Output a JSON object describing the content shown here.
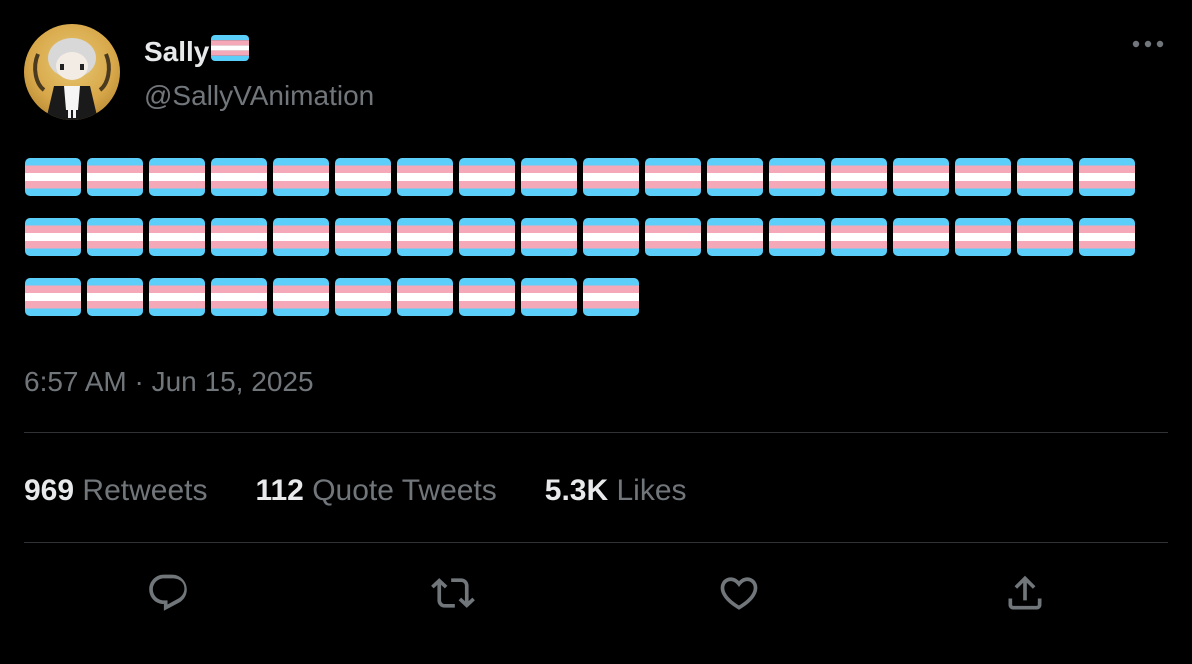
{
  "tweet": {
    "author": {
      "display_name": "Sally",
      "name_emoji": "transgender-flag-emoji",
      "handle": "@SallyVAnimation"
    },
    "body": {
      "emoji": "transgender-flag-emoji",
      "emoji_count": 46,
      "rows": [
        18,
        18,
        10
      ]
    },
    "timestamp": "6:57 AM · Jun 15, 2025",
    "stats": [
      {
        "count": "969",
        "label": "Retweets"
      },
      {
        "count": "112",
        "label": "Quote Tweets"
      },
      {
        "count": "5.3K",
        "label": "Likes"
      }
    ],
    "actions": [
      {
        "icon": "reply-icon"
      },
      {
        "icon": "retweet-icon"
      },
      {
        "icon": "like-icon"
      },
      {
        "icon": "share-icon"
      }
    ]
  },
  "colors": {
    "background": "#000000",
    "primary_text": "#e7e9ea",
    "secondary_text": "#71767b",
    "divider": "#2f3336",
    "flag_blue": "#5bcefa",
    "flag_pink": "#f5a9b8",
    "flag_white": "#ffffff"
  }
}
